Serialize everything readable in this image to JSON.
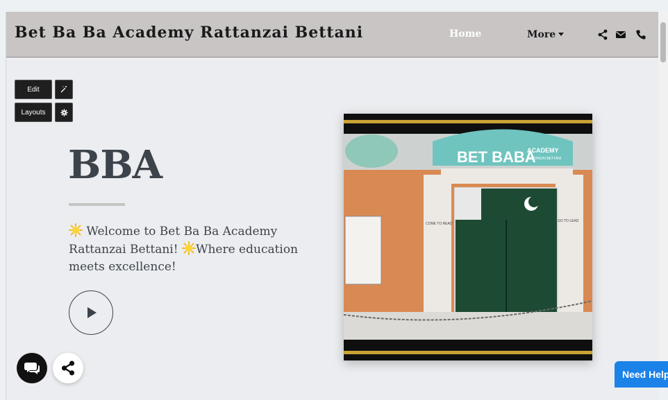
{
  "header": {
    "site_title": "Bet Ba Ba Academy Rattanzai Bettani",
    "nav": {
      "home": "Home",
      "more": "More"
    }
  },
  "toolbar": {
    "edit_label": "Edit",
    "layouts_label": "Layouts"
  },
  "hero": {
    "title": "BBA",
    "text_part1": " Welcome to Bet Ba Ba Academy Rattanzai Bettani! ",
    "text_part2": "Where education meets excellence!"
  },
  "photo": {
    "school_sign": "BET BABA",
    "school_sign_small": "ACADEMY",
    "sign_sub": "RATTANZAI BETTANI",
    "wall_left": "COME TO READ",
    "wall_right": "GO TO LEAD"
  },
  "help": {
    "label": "Need Help"
  },
  "icons": {
    "share": "share-icon",
    "email": "envelope-icon",
    "phone": "phone-icon",
    "magic": "magic-wand-icon",
    "settings": "gear-icon",
    "sun": "sun-emoji-icon",
    "play": "play-icon",
    "chat": "chat-icon"
  },
  "colors": {
    "header_bg": "#c9c5c5",
    "page_bg": "#ebedf0",
    "text_dark": "#3d434b",
    "help_blue": "#1b82e8",
    "door_green": "#1d4a33",
    "wall_orange": "#d98a52"
  }
}
